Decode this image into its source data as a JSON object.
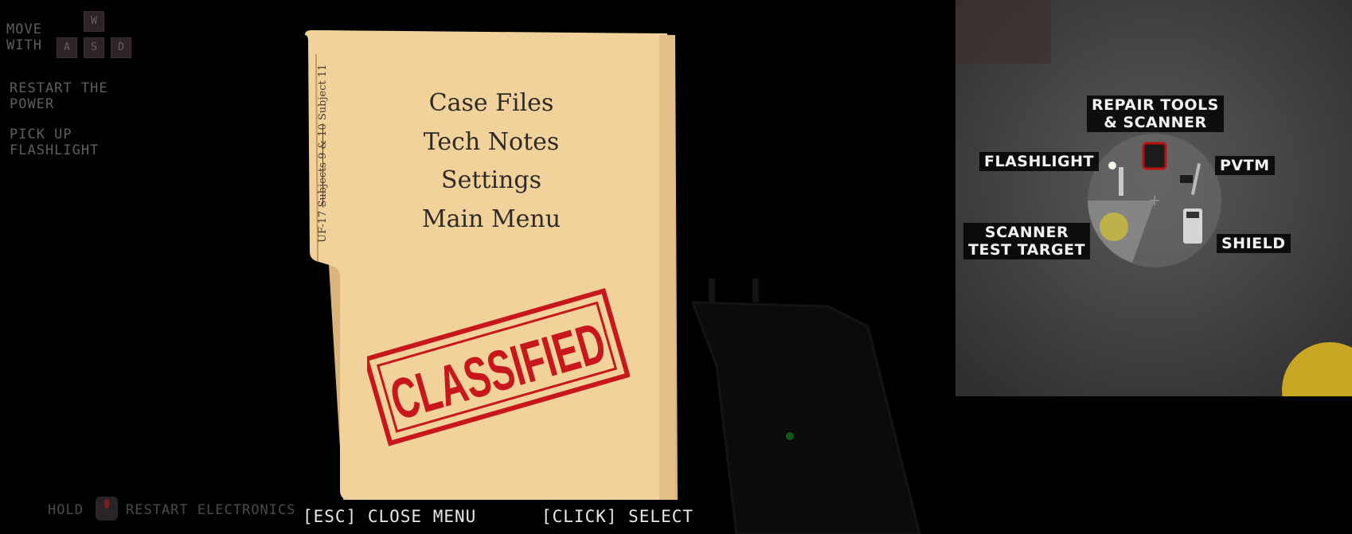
{
  "hud": {
    "move_label": "MOVE\nWITH",
    "keys": {
      "w": "W",
      "a": "A",
      "s": "S",
      "d": "D"
    },
    "objectives": [
      "RESTART THE\nPOWER",
      "PICK UP\nFLASHLIGHT"
    ],
    "hold_label": "HOLD",
    "restart_electronics": "RESTART ELECTRONICS"
  },
  "folder": {
    "tab_prefix": "UF-17 ",
    "tab_struck": "Subjects 9 & 10",
    "tab_suffix": " Subject 11",
    "menu": [
      "Case Files",
      "Tech Notes",
      "Settings",
      "Main Menu"
    ],
    "stamp": "CLASSIFIED",
    "stamp_color": "#c8161d"
  },
  "controls": {
    "close": "[ESC] CLOSE MENU",
    "select": "[CLICK] SELECT"
  },
  "tool_wheel": {
    "repair": "REPAIR TOOLS\n& SCANNER",
    "flashlight": "FLASHLIGHT",
    "pvtm": "PVTM",
    "scanner_target": "SCANNER\nTEST TARGET",
    "shield": "SHIELD"
  }
}
